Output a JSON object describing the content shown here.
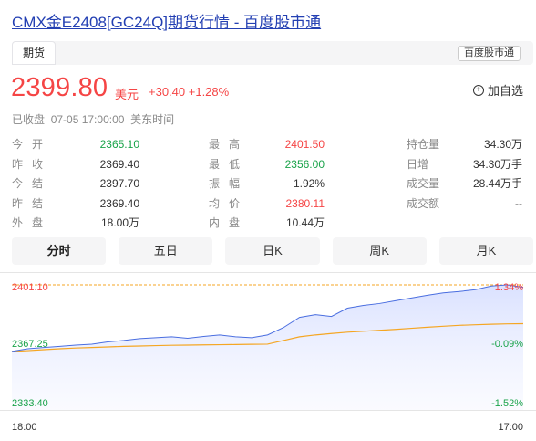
{
  "page": {
    "title": "CMX金E2408[GC24Q]期货行情 - 百度股市通"
  },
  "tabbar": {
    "active_tab": "期货",
    "source_button": "百度股市通"
  },
  "quote": {
    "price": "2399.80",
    "currency": "美元",
    "change": "+30.40",
    "change_pct": "+1.28%",
    "watch_label": "加自选",
    "status": "已收盘",
    "time": "07-05 17:00:00",
    "timezone": "美东时间"
  },
  "stats": {
    "col1": [
      {
        "label": "今开",
        "value": "2365.10",
        "color": "green"
      },
      {
        "label": "昨收",
        "value": "2369.40",
        "color": ""
      },
      {
        "label": "今结",
        "value": "2397.70",
        "color": ""
      },
      {
        "label": "昨结",
        "value": "2369.40",
        "color": ""
      },
      {
        "label": "外盘",
        "value": "18.00万",
        "color": ""
      }
    ],
    "col2": [
      {
        "label": "最高",
        "value": "2401.50",
        "color": "red"
      },
      {
        "label": "最低",
        "value": "2356.00",
        "color": "green"
      },
      {
        "label": "振幅",
        "value": "1.92%",
        "color": ""
      },
      {
        "label": "均价",
        "value": "2380.11",
        "color": "red"
      },
      {
        "label": "内盘",
        "value": "10.44万",
        "color": ""
      }
    ],
    "col3": [
      {
        "label": "持仓量",
        "value": "34.30万",
        "color": ""
      },
      {
        "label": "日增",
        "value": "34.30万手",
        "color": ""
      },
      {
        "label": "成交量",
        "value": "28.44万手",
        "color": ""
      },
      {
        "label": "成交额",
        "value": "--",
        "color": ""
      }
    ]
  },
  "period_tabs": [
    "分时",
    "五日",
    "日K",
    "周K",
    "月K"
  ],
  "active_period": "分时",
  "chart": {
    "y_top_label": "2401.10",
    "y_mid_label": "2367.25",
    "y_bottom_label": "2333.40",
    "pct_top_label": "1.34%",
    "pct_mid_label": "-0.09%",
    "pct_bottom_label": "-1.52%",
    "x_start": "18:00",
    "x_end": "17:00",
    "price_line_color": "#4a6ee0",
    "avg_line_color": "#f5a623",
    "up_color": "#f54545",
    "down_color": "#1aa34a"
  },
  "chart_data": {
    "type": "line",
    "y_range": [
      2333.4,
      2401.1
    ],
    "pct_range": [
      -1.52,
      1.34
    ],
    "x_range": [
      "18:00",
      "17:00"
    ],
    "series": [
      {
        "values": [
          2365.1,
          2366.5,
          2367.2,
          2367.8,
          2368.5,
          2369.0,
          2370.2,
          2371.0,
          2372.0,
          2372.5,
          2373.0,
          2372.2,
          2373.2,
          2374.0,
          2373.0,
          2372.5,
          2374.0,
          2378.0,
          2383.5,
          2385.0,
          2384.0,
          2388.5,
          2390.0,
          2391.0,
          2392.5,
          2394.0,
          2395.5,
          2396.8,
          2397.5,
          2398.5,
          2400.5,
          2401.1,
          2399.8
        ]
      },
      {
        "values": [
          2365.1,
          2365.5,
          2366.0,
          2366.5,
          2366.9,
          2367.2,
          2367.5,
          2367.8,
          2368.0,
          2368.2,
          2368.4,
          2368.5,
          2368.6,
          2368.7,
          2368.8,
          2368.9,
          2369.0,
          2371.0,
          2373.0,
          2374.0,
          2374.8,
          2375.5,
          2376.0,
          2376.5,
          2377.0,
          2377.6,
          2378.2,
          2378.7,
          2379.2,
          2379.5,
          2379.8,
          2380.0,
          2380.11
        ]
      }
    ]
  }
}
